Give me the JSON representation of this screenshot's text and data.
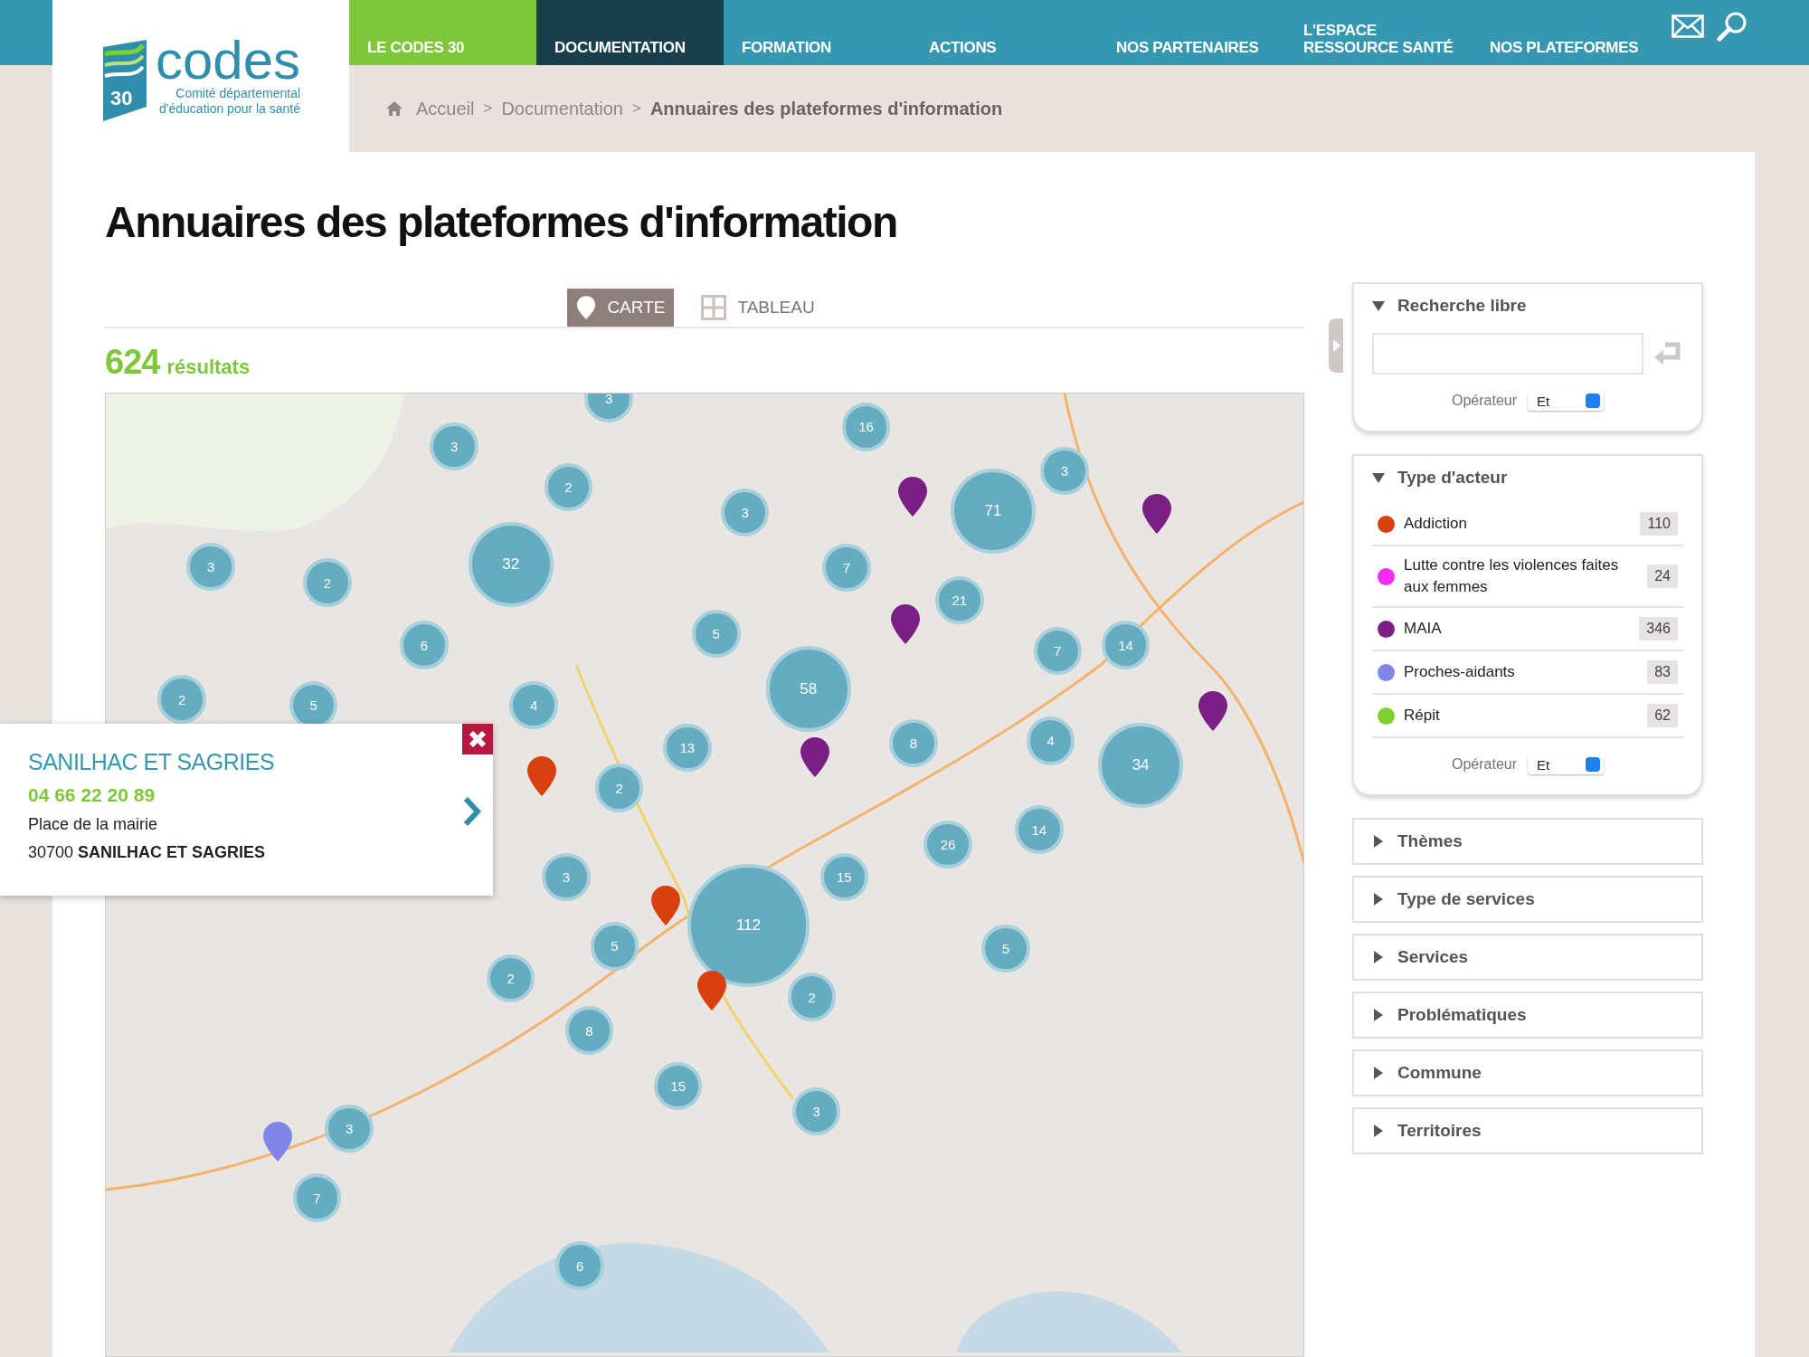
{
  "logo": {
    "word": "codes",
    "number": "30",
    "line_1": "Comité départemental",
    "line_2": "d'éducation pour la santé"
  },
  "nav": [
    {
      "label": "LE CODES 30",
      "kind": "accent",
      "selected": false
    },
    {
      "label": "DOCUMENTATION",
      "kind": "normal",
      "selected": true
    },
    {
      "label": "FORMATION",
      "kind": "normal",
      "selected": false
    },
    {
      "label": "ACTIONS",
      "kind": "normal",
      "selected": false
    },
    {
      "label": "NOS PARTENAIRES",
      "kind": "normal",
      "selected": false
    },
    {
      "label": "L'ESPACE RESSOURCE SANTÉ",
      "kind": "normal",
      "selected": false
    },
    {
      "label": "NOS PLATEFORMES",
      "kind": "normal",
      "selected": false
    }
  ],
  "breadcrumb": {
    "separator": ">",
    "items": [
      "Accueil",
      "Documentation",
      "Annuaires des plateformes d'information"
    ]
  },
  "title": "Annuaires des plateformes d'information",
  "view_tabs": [
    {
      "label": "CARTE",
      "kind": "map",
      "selected": true
    },
    {
      "label": "TABLEAU",
      "kind": "table",
      "selected": false
    }
  ],
  "results": {
    "count": "624",
    "label": "résultats"
  },
  "map": {
    "clusters": [
      "3",
      "16",
      "3",
      "3",
      "2",
      "3",
      "71",
      "3",
      "32",
      "7",
      "2",
      "21",
      "5",
      "6",
      "7",
      "14",
      "58",
      "2",
      "5",
      "4",
      "13",
      "8",
      "4",
      "34",
      "2",
      "14",
      "26",
      "3",
      "15",
      "112",
      "5",
      "5",
      "2",
      "2",
      "8",
      "15",
      "3",
      "3",
      "7",
      "6"
    ],
    "markers": [
      {
        "color": "#7b1f85"
      },
      {
        "color": "#7b1f85"
      },
      {
        "color": "#7b1f85"
      },
      {
        "color": "#7b1f85"
      },
      {
        "color": "#7b1f85"
      },
      {
        "color": "#d9400f"
      },
      {
        "color": "#d9400f"
      },
      {
        "color": "#d9400f"
      },
      {
        "color": "#7f86e8"
      }
    ]
  },
  "popup": {
    "name": "SANILHAC ET SAGRIES",
    "phone": "04 66 22 20 89",
    "address": "Place de la mairie",
    "postcode": "30700",
    "city": "SANILHAC ET SAGRIES"
  },
  "panels": [
    {
      "title": "Recherche libre",
      "kind": "search",
      "expanded": true,
      "operator_label": "Opérateur",
      "operator": "Et"
    },
    {
      "title": "Type d'acteur",
      "kind": "legend",
      "expanded": true,
      "operator_label": "Opérateur",
      "operator": "Et",
      "items": [
        {
          "label": "Addiction",
          "color": "#d9400f",
          "count": "110"
        },
        {
          "label": "Lutte contre les violences faites aux femmes",
          "color": "#f52cf0",
          "count": "24"
        },
        {
          "label": "MAIA",
          "color": "#7b1f85",
          "count": "346"
        },
        {
          "label": "Proches-aidants",
          "color": "#7f86e8",
          "count": "83"
        },
        {
          "label": "Répit",
          "color": "#7ed031",
          "count": "62"
        }
      ]
    },
    {
      "title": "Thèmes",
      "kind": "plain",
      "expanded": false
    },
    {
      "title": "Type de services",
      "kind": "plain",
      "expanded": false
    },
    {
      "title": "Services",
      "kind": "plain",
      "expanded": false
    },
    {
      "title": "Problématiques",
      "kind": "plain",
      "expanded": false
    },
    {
      "title": "Commune",
      "kind": "plain",
      "expanded": false
    },
    {
      "title": "Territoires",
      "kind": "plain",
      "expanded": false
    }
  ]
}
